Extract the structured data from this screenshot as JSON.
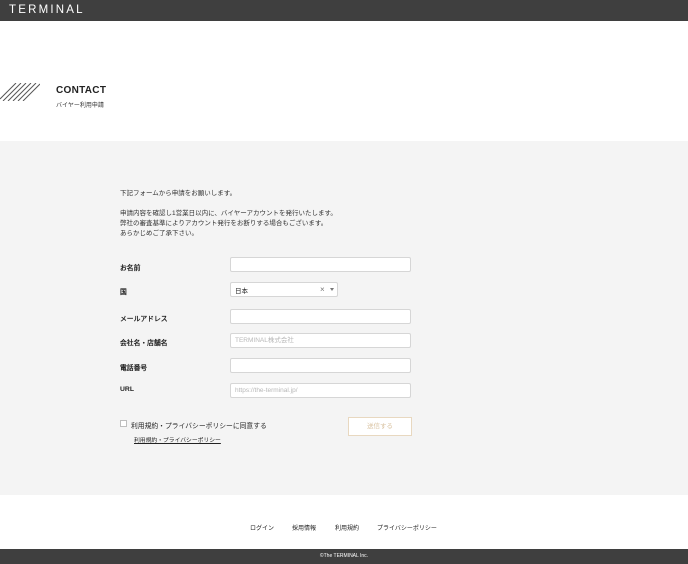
{
  "header": {
    "logo": "TERMINAL"
  },
  "hero": {
    "title": "CONTACT",
    "subtitle": "バイヤー利用申請"
  },
  "intro": {
    "line1": "下記フォームから申請をお願いします。",
    "line2": "申請内容を確認し1営業日以内に、バイヤーアカウントを発行いたします。",
    "line3": "弊社の審査基準によりアカウント発行をお断りする場合もございます。",
    "line4": "あらかじめご了承下さい。"
  },
  "form": {
    "name": {
      "label": "お名前",
      "value": "",
      "placeholder": ""
    },
    "country": {
      "label": "国",
      "value": "日本",
      "clear": "×"
    },
    "email": {
      "label": "メールアドレス",
      "value": "",
      "placeholder": ""
    },
    "company": {
      "label": "会社名・店舗名",
      "value": "",
      "placeholder": "TERMINAL株式会社"
    },
    "phone": {
      "label": "電話番号",
      "value": "",
      "placeholder": ""
    },
    "url": {
      "label": "URL",
      "value": "",
      "placeholder": "https://the-terminal.jp/"
    },
    "agree_label": "利用規約・プライバシーポリシーに同意する",
    "terms_link": "利用規約・プライバシーポリシー",
    "submit_label": "送信する"
  },
  "footer": {
    "links": [
      "ログイン",
      "採用情報",
      "利用規約",
      "プライバシーポリシー"
    ],
    "copyright": "©The TERMINAL Inc."
  },
  "colors": {
    "bar": "#3f3f3f",
    "section_bg": "#f4f4f4",
    "accent": "#d9c2a0"
  }
}
